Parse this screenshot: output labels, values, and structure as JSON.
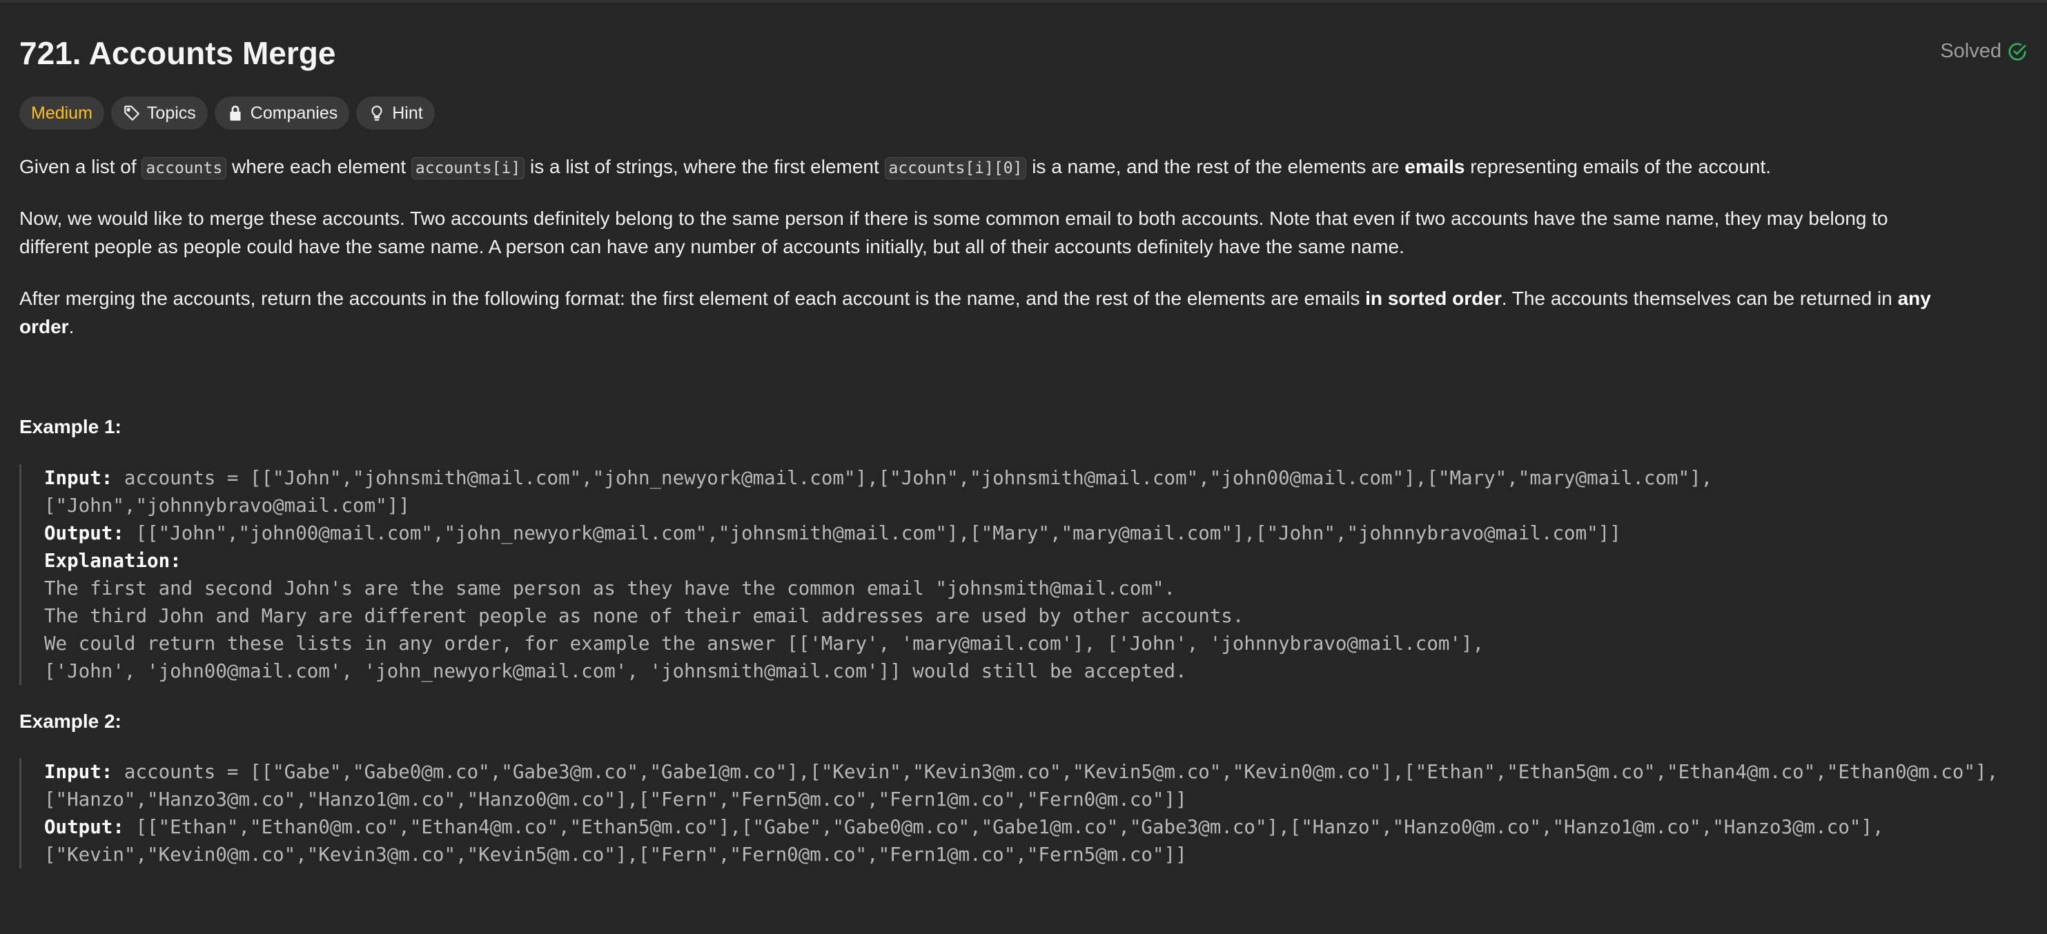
{
  "problem": {
    "title": "721. Accounts Merge",
    "status": "Solved"
  },
  "tags": {
    "difficulty": "Medium",
    "topics": "Topics",
    "companies": "Companies",
    "hint": "Hint"
  },
  "description": {
    "p1_a": "Given a list of ",
    "p1_code1": "accounts",
    "p1_b": " where each element ",
    "p1_code2": "accounts[i]",
    "p1_c": " is a list of strings, where the first element ",
    "p1_code3": "accounts[i][0]",
    "p1_d": " is a name, and the rest of the elements are ",
    "p1_bold": "emails",
    "p1_e": " representing emails of the account.",
    "p2_line1": "Now, we would like to merge these accounts. Two accounts definitely belong to the same person if there is some common email to both accounts. Note that even if two accounts have the same name, they may belong to",
    "p2_line2": "different people as people could have the same name. A person can have any number of accounts initially, but all of their accounts definitely have the same name.",
    "p3_a": "After merging the accounts, return the accounts in the following format: the first element of each account is the name, and the rest of the elements are emails ",
    "p3_bold1": "in sorted order",
    "p3_b": ". The accounts themselves can be returned in ",
    "p3_bold2a": "any",
    "p3_bold2b": "order",
    "p3_c": "."
  },
  "example1": {
    "title": "Example 1:",
    "input_label": "Input:",
    "input_line1": " accounts = [[\"John\",\"johnsmith@mail.com\",\"john_newyork@mail.com\"],[\"John\",\"johnsmith@mail.com\",\"john00@mail.com\"],[\"Mary\",\"mary@mail.com\"],",
    "input_line2": "[\"John\",\"johnnybravo@mail.com\"]]",
    "output_label": "Output:",
    "output_line1": " [[\"John\",\"john00@mail.com\",\"john_newyork@mail.com\",\"johnsmith@mail.com\"],[\"Mary\",\"mary@mail.com\"],[\"John\",\"johnnybravo@mail.com\"]]",
    "explanation_label": "Explanation:",
    "exp_line1": "The first and second John's are the same person as they have the common email \"johnsmith@mail.com\".",
    "exp_line2": "The third John and Mary are different people as none of their email addresses are used by other accounts.",
    "exp_line3": "We could return these lists in any order, for example the answer [['Mary', 'mary@mail.com'], ['John', 'johnnybravo@mail.com'],",
    "exp_line4": "['John', 'john00@mail.com', 'john_newyork@mail.com', 'johnsmith@mail.com']] would still be accepted."
  },
  "example2": {
    "title": "Example 2:",
    "input_label": "Input:",
    "input_line1": " accounts = [[\"Gabe\",\"Gabe0@m.co\",\"Gabe3@m.co\",\"Gabe1@m.co\"],[\"Kevin\",\"Kevin3@m.co\",\"Kevin5@m.co\",\"Kevin0@m.co\"],[\"Ethan\",\"Ethan5@m.co\",\"Ethan4@m.co\",\"Ethan0@m.co\"],",
    "input_line2": "[\"Hanzo\",\"Hanzo3@m.co\",\"Hanzo1@m.co\",\"Hanzo0@m.co\"],[\"Fern\",\"Fern5@m.co\",\"Fern1@m.co\",\"Fern0@m.co\"]]",
    "output_label": "Output:",
    "output_line1": " [[\"Ethan\",\"Ethan0@m.co\",\"Ethan4@m.co\",\"Ethan5@m.co\"],[\"Gabe\",\"Gabe0@m.co\",\"Gabe1@m.co\",\"Gabe3@m.co\"],[\"Hanzo\",\"Hanzo0@m.co\",\"Hanzo1@m.co\",\"Hanzo3@m.co\"],",
    "output_line2": "[\"Kevin\",\"Kevin0@m.co\",\"Kevin3@m.co\",\"Kevin5@m.co\"],[\"Fern\",\"Fern0@m.co\",\"Fern1@m.co\",\"Fern5@m.co\"]]"
  },
  "colors": {
    "background": "#262626",
    "medium": "#ffc01e",
    "solved_check": "#2cbb5d"
  },
  "icons": {
    "solved": "check-circle-icon",
    "topics": "tag-icon",
    "companies": "lock-icon",
    "hint": "lightbulb-icon"
  }
}
